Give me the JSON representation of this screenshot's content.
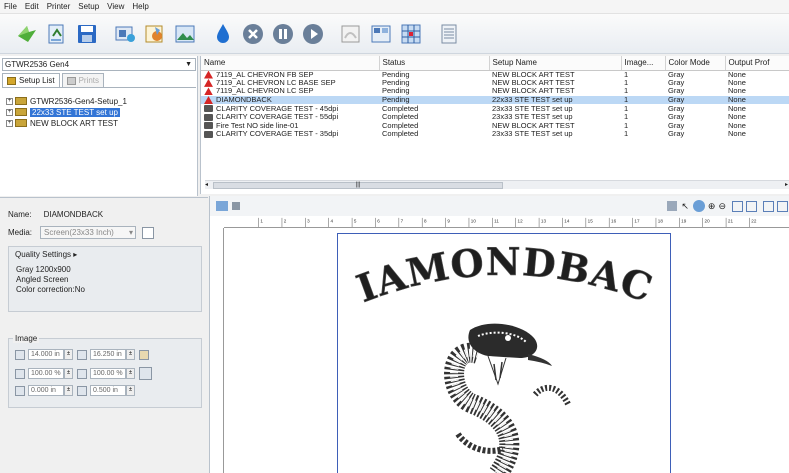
{
  "menu": [
    "File",
    "Edit",
    "Printer",
    "Setup",
    "View",
    "Help"
  ],
  "toolbar": {
    "icons": [
      "open-icon",
      "import-icon",
      "save-icon",
      "printer-settings-icon",
      "setup-icon",
      "image-icon",
      "ink-drop-icon",
      "cancel-icon",
      "pause-icon",
      "play-icon",
      "print-preview-icon",
      "grid-view-icon",
      "layout-icon",
      "queue-icon"
    ]
  },
  "printer_select": "GTWR2536 Gen4",
  "tabs": {
    "setup_list": "Setup List",
    "prints": "Prints"
  },
  "tree": [
    {
      "label": "GTWR2536-Gen4-Setup_1",
      "selected": false
    },
    {
      "label": "22x33 STE TEST set up",
      "selected": true
    },
    {
      "label": "NEW BLOCK ART TEST",
      "selected": false
    }
  ],
  "jobs": {
    "columns": [
      "Name",
      "Status",
      "Setup Name",
      "Image...",
      "Color Mode",
      "Output Prof"
    ],
    "rows": [
      {
        "icon": "err",
        "name": "7119_AL CHEVRON FB SEP",
        "status": "Pending",
        "setup": "NEW BLOCK ART TEST",
        "image": "1",
        "color": "Gray",
        "output": "None",
        "selected": false
      },
      {
        "icon": "err",
        "name": "7119_AL CHEVRON LC BASE SEP",
        "status": "Pending",
        "setup": "NEW BLOCK ART TEST",
        "image": "1",
        "color": "Gray",
        "output": "None",
        "selected": false
      },
      {
        "icon": "err",
        "name": "7119_AL CHEVRON LC SEP",
        "status": "Pending",
        "setup": "NEW BLOCK ART TEST",
        "image": "1",
        "color": "Gray",
        "output": "None",
        "selected": false
      },
      {
        "icon": "err",
        "name": "DIAMONDBACK",
        "status": "Pending",
        "setup": "22x33 STE TEST set up",
        "image": "1",
        "color": "Gray",
        "output": "None",
        "selected": true
      },
      {
        "icon": "ok",
        "name": "CLARITY COVERAGE TEST - 45dpi",
        "status": "Completed",
        "setup": "23x33 STE TEST set up",
        "image": "1",
        "color": "Gray",
        "output": "None",
        "selected": false
      },
      {
        "icon": "ok",
        "name": "CLARITY COVERAGE TEST - 55dpi",
        "status": "Completed",
        "setup": "23x33 STE TEST set up",
        "image": "1",
        "color": "Gray",
        "output": "None",
        "selected": false
      },
      {
        "icon": "ok",
        "name": "Fire Test NO side line-01",
        "status": "Completed",
        "setup": "NEW BLOCK ART TEST",
        "image": "1",
        "color": "Gray",
        "output": "None",
        "selected": false
      },
      {
        "icon": "ok",
        "name": "CLARITY COVERAGE TEST - 35dpi",
        "status": "Completed",
        "setup": "23x33 STE TEST set up",
        "image": "1",
        "color": "Gray",
        "output": "None",
        "selected": false
      }
    ]
  },
  "details": {
    "name_label": "Name:",
    "name_value": "DIAMONDBACK",
    "media_label": "Media:",
    "media_value": "Screen(23x33 Inch)",
    "quality_title": "Quality Settings",
    "quality_lines": [
      "Gray  1200x900",
      "Angled Screen",
      "Color correction:No"
    ],
    "image_title": "Image",
    "width": "14.000 in",
    "height": "16.250 in",
    "scale_x": "100.00 %",
    "scale_y": "100.00 %",
    "pos_x": "0.000 in",
    "pos_y": "0.500 in"
  },
  "preview": {
    "ruler_numbers": [
      "1",
      "2",
      "3",
      "4",
      "5",
      "6",
      "7",
      "8",
      "9",
      "10",
      "11",
      "12",
      "13",
      "14",
      "15",
      "16",
      "17",
      "18",
      "19",
      "20",
      "21",
      "22"
    ],
    "art_text": "DIAMONDBACK"
  },
  "colors": {
    "selection": "#3375d6",
    "row_selected": "#bcd8f5",
    "sheet_border": "#3e5fb8",
    "error": "#d62626"
  }
}
